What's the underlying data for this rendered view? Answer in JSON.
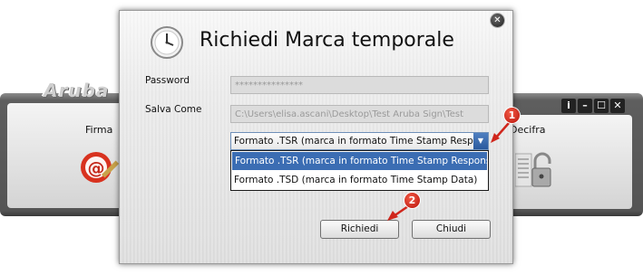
{
  "background_app": {
    "logo": "Aruba",
    "left_label": "Firma",
    "right_label": "Decifra",
    "window_controls": [
      "i",
      "–",
      "☐",
      "✕"
    ]
  },
  "dialog": {
    "title": "Richiedi Marca temporale",
    "close_glyph": "✕",
    "password": {
      "label": "Password",
      "value": "***************"
    },
    "save_as": {
      "label": "Salva Come",
      "value": "C:\\Users\\elisa.ascani\\Desktop\\Test Aruba Sign\\Test"
    },
    "format_select": {
      "selected": "Formato .TSR (marca in formato Time Stamp Respo...",
      "options": [
        "Formato .TSR (marca in formato Time Stamp Response)",
        "Formato .TSD (marca in formato Time Stamp Data)"
      ],
      "highlighted_index": 0
    },
    "buttons": {
      "request": "Richiedi",
      "close": "Chiudi"
    }
  },
  "annotations": [
    {
      "number": "1"
    },
    {
      "number": "2"
    }
  ],
  "colors": {
    "highlight": "#3b6db3",
    "annotation_red": "#d0261c"
  }
}
